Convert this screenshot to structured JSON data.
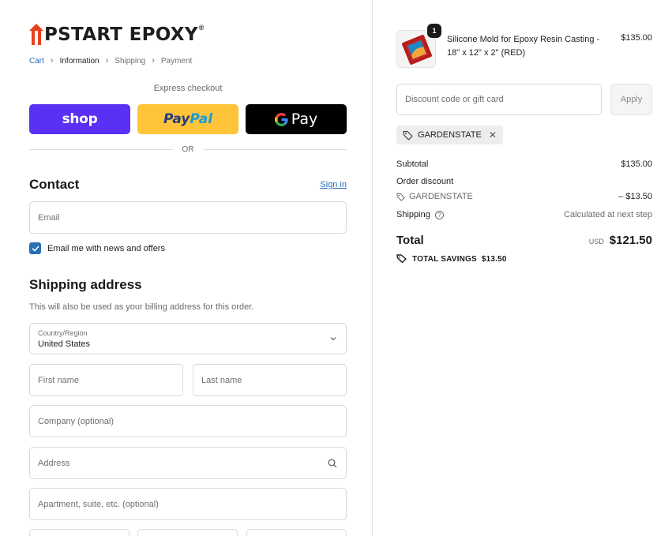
{
  "brand": {
    "name": "PSTART EPOXY",
    "registered": "®"
  },
  "breadcrumb": [
    {
      "label": "Cart",
      "state": "link"
    },
    {
      "label": "Information",
      "state": "active"
    },
    {
      "label": "Shipping",
      "state": "muted"
    },
    {
      "label": "Payment",
      "state": "muted"
    }
  ],
  "express": {
    "label": "Express checkout",
    "shop": "shop",
    "paypal_a": "Pay",
    "paypal_b": "Pal",
    "gpay_g": "G",
    "gpay_text": "Pay"
  },
  "divider_text": "OR",
  "contact": {
    "title": "Contact",
    "signin": "Sign in",
    "email_placeholder": "Email",
    "newsletter_label": "Email me with news and offers",
    "newsletter_checked": true
  },
  "shipping": {
    "title": "Shipping address",
    "description": "This will also be used as your billing address for this order.",
    "country_label": "Country/Region",
    "country_value": "United States",
    "first_name": "First name",
    "last_name": "Last name",
    "company": "Company (optional)",
    "address": "Address",
    "apartment": "Apartment, suite, etc. (optional)"
  },
  "cart": {
    "item": {
      "name": "Silicone Mold for Epoxy Resin Casting - 18\" x 12\" x 2\" (RED)",
      "price": "$135.00",
      "quantity": "1"
    },
    "discount_placeholder": "Discount code or gift card",
    "apply_label": "Apply",
    "applied_code": "GARDENSTATE",
    "subtotal_label": "Subtotal",
    "subtotal_value": "$135.00",
    "order_discount_label": "Order discount",
    "discount_code": "GARDENSTATE",
    "discount_value": "– $13.50",
    "shipping_label": "Shipping",
    "shipping_value": "Calculated at next step",
    "total_label": "Total",
    "currency": "USD",
    "total_value": "$121.50",
    "savings_label": "TOTAL SAVINGS",
    "savings_value": "$13.50"
  },
  "colors": {
    "accent": "#2a6eb5",
    "shop": "#5a31f4",
    "paypal": "#ffc439",
    "gpay": "#000000",
    "logo_red": "#e8401c"
  }
}
